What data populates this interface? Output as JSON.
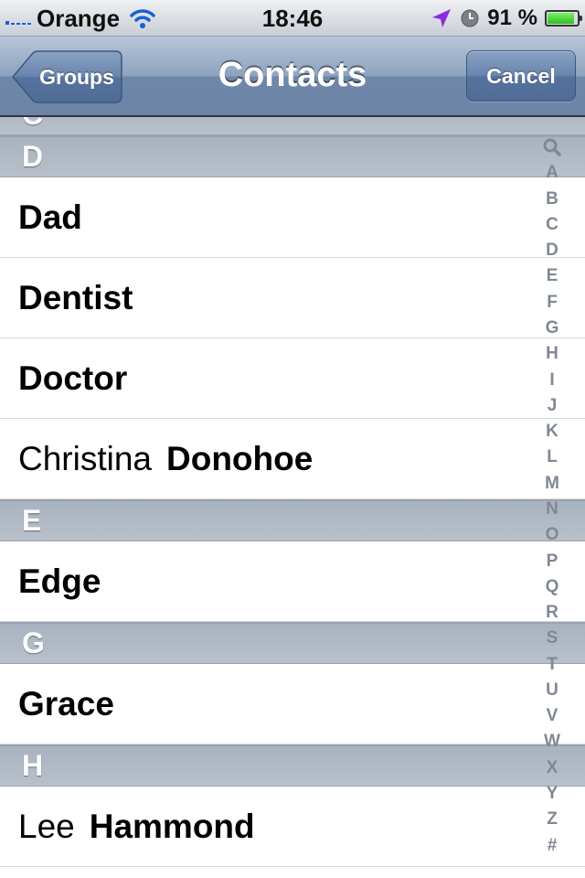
{
  "status_bar": {
    "carrier": "Orange",
    "time": "18:46",
    "battery_percent": "91 %",
    "battery_level": 0.91,
    "icons": [
      "signal-icon",
      "wifi-icon",
      "location-arrow-icon",
      "alarm-clock-icon",
      "battery-icon"
    ]
  },
  "nav": {
    "title": "Contacts",
    "back_label": "Groups",
    "cancel_label": "Cancel"
  },
  "list": {
    "prev_header_partial": "C",
    "sections": [
      {
        "letter": "D",
        "rows": [
          {
            "first": "",
            "last": "Dad"
          },
          {
            "first": "",
            "last": "Dentist"
          },
          {
            "first": "",
            "last": "Doctor"
          },
          {
            "first": "Christina",
            "last": "Donohoe"
          }
        ]
      },
      {
        "letter": "E",
        "rows": [
          {
            "first": "",
            "last": "Edge"
          }
        ]
      },
      {
        "letter": "G",
        "rows": [
          {
            "first": "",
            "last": "Grace"
          }
        ]
      },
      {
        "letter": "H",
        "rows": [
          {
            "first": "Lee",
            "last": "Hammond"
          }
        ]
      }
    ]
  },
  "index": [
    "A",
    "B",
    "C",
    "D",
    "E",
    "F",
    "G",
    "H",
    "I",
    "J",
    "K",
    "L",
    "M",
    "N",
    "O",
    "P",
    "Q",
    "R",
    "S",
    "T",
    "U",
    "V",
    "W",
    "X",
    "Y",
    "Z",
    "#"
  ],
  "colors": {
    "nav_bar": "#7f96b6",
    "section_header": "#b0bac5",
    "index_text": "#7f8894",
    "signal_blue": "#1b5fd6",
    "location_purple": "#8a2be2",
    "battery_green": "#2fbf22"
  }
}
